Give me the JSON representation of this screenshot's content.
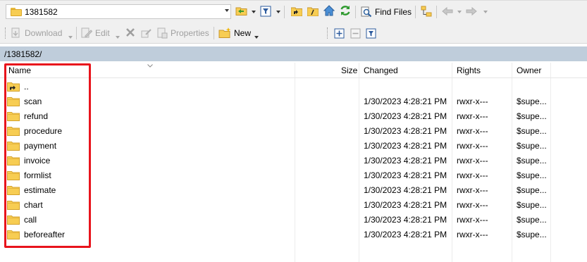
{
  "toolbar": {
    "path_value": "1381582",
    "find_files_label": "Find Files",
    "download_label": "Download",
    "edit_label": "Edit",
    "properties_label": "Properties",
    "new_label": "New"
  },
  "path_bar": {
    "path": "/1381582/"
  },
  "columns": {
    "name": "Name",
    "size": "Size",
    "changed": "Changed",
    "rights": "Rights",
    "owner": "Owner"
  },
  "files": [
    {
      "name": "..",
      "changed": "",
      "rights": "",
      "owner": "",
      "icon": "parent-folder-icon"
    },
    {
      "name": "scan",
      "changed": "1/30/2023 4:28:21 PM",
      "rights": "rwxr-x---",
      "owner": "$supe...",
      "icon": "folder-icon"
    },
    {
      "name": "refund",
      "changed": "1/30/2023 4:28:21 PM",
      "rights": "rwxr-x---",
      "owner": "$supe...",
      "icon": "folder-icon"
    },
    {
      "name": "procedure",
      "changed": "1/30/2023 4:28:21 PM",
      "rights": "rwxr-x---",
      "owner": "$supe...",
      "icon": "folder-icon"
    },
    {
      "name": "payment",
      "changed": "1/30/2023 4:28:21 PM",
      "rights": "rwxr-x---",
      "owner": "$supe...",
      "icon": "folder-icon"
    },
    {
      "name": "invoice",
      "changed": "1/30/2023 4:28:21 PM",
      "rights": "rwxr-x---",
      "owner": "$supe...",
      "icon": "folder-icon"
    },
    {
      "name": "formlist",
      "changed": "1/30/2023 4:28:21 PM",
      "rights": "rwxr-x---",
      "owner": "$supe...",
      "icon": "folder-icon"
    },
    {
      "name": "estimate",
      "changed": "1/30/2023 4:28:21 PM",
      "rights": "rwxr-x---",
      "owner": "$supe...",
      "icon": "folder-icon"
    },
    {
      "name": "chart",
      "changed": "1/30/2023 4:28:21 PM",
      "rights": "rwxr-x---",
      "owner": "$supe...",
      "icon": "folder-icon"
    },
    {
      "name": "call",
      "changed": "1/30/2023 4:28:21 PM",
      "rights": "rwxr-x---",
      "owner": "$supe...",
      "icon": "folder-icon"
    },
    {
      "name": "beforeafter",
      "changed": "1/30/2023 4:28:21 PM",
      "rights": "rwxr-x---",
      "owner": "$supe...",
      "icon": "folder-icon"
    }
  ],
  "colors": {
    "highlight_border": "#e8141c",
    "path_bar_bg": "#bfcddb",
    "folder_fill": "#f7cd53"
  }
}
